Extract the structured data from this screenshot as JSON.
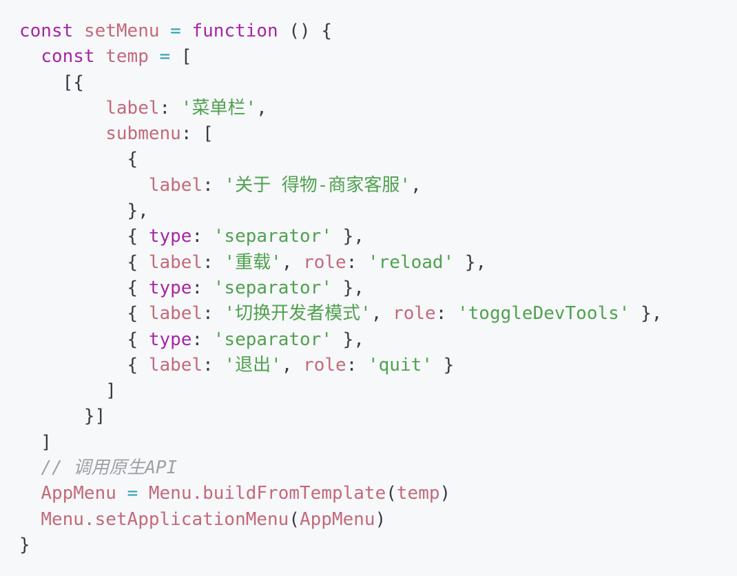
{
  "code": {
    "lines": [
      [
        [
          "kw",
          "const"
        ],
        [
          "punc",
          " "
        ],
        [
          "var",
          "setMenu"
        ],
        [
          "punc",
          " "
        ],
        [
          "op",
          "="
        ],
        [
          "punc",
          " "
        ],
        [
          "kw",
          "function"
        ],
        [
          "punc",
          " () {"
        ]
      ],
      [
        [
          "punc",
          "  "
        ],
        [
          "kw",
          "const"
        ],
        [
          "punc",
          " "
        ],
        [
          "var",
          "temp"
        ],
        [
          "punc",
          " "
        ],
        [
          "op",
          "="
        ],
        [
          "punc",
          " ["
        ]
      ],
      [
        [
          "punc",
          "    [{"
        ]
      ],
      [
        [
          "punc",
          "        "
        ],
        [
          "var",
          "label"
        ],
        [
          "punc",
          ": "
        ],
        [
          "str",
          "'菜单栏'"
        ],
        [
          "punc",
          ","
        ]
      ],
      [
        [
          "punc",
          "        "
        ],
        [
          "var",
          "submenu"
        ],
        [
          "punc",
          ": ["
        ]
      ],
      [
        [
          "punc",
          "          {"
        ]
      ],
      [
        [
          "punc",
          "            "
        ],
        [
          "var",
          "label"
        ],
        [
          "punc",
          ": "
        ],
        [
          "str",
          "'关于 得物-商家客服'"
        ],
        [
          "punc",
          ","
        ]
      ],
      [
        [
          "punc",
          "          },"
        ]
      ],
      [
        [
          "punc",
          "          { "
        ],
        [
          "kw",
          "type"
        ],
        [
          "punc",
          ": "
        ],
        [
          "str",
          "'separator'"
        ],
        [
          "punc",
          " },"
        ]
      ],
      [
        [
          "punc",
          "          { "
        ],
        [
          "var",
          "label"
        ],
        [
          "punc",
          ": "
        ],
        [
          "str",
          "'重载'"
        ],
        [
          "punc",
          ", "
        ],
        [
          "var",
          "role"
        ],
        [
          "punc",
          ": "
        ],
        [
          "str",
          "'reload'"
        ],
        [
          "punc",
          " },"
        ]
      ],
      [
        [
          "punc",
          "          { "
        ],
        [
          "kw",
          "type"
        ],
        [
          "punc",
          ": "
        ],
        [
          "str",
          "'separator'"
        ],
        [
          "punc",
          " },"
        ]
      ],
      [
        [
          "punc",
          "          { "
        ],
        [
          "var",
          "label"
        ],
        [
          "punc",
          ": "
        ],
        [
          "str",
          "'切换开发者模式'"
        ],
        [
          "punc",
          ", "
        ],
        [
          "var",
          "role"
        ],
        [
          "punc",
          ": "
        ],
        [
          "str",
          "'toggleDevTools'"
        ],
        [
          "punc",
          " },"
        ]
      ],
      [
        [
          "punc",
          "          { "
        ],
        [
          "kw",
          "type"
        ],
        [
          "punc",
          ": "
        ],
        [
          "str",
          "'separator'"
        ],
        [
          "punc",
          " },"
        ]
      ],
      [
        [
          "punc",
          "          { "
        ],
        [
          "var",
          "label"
        ],
        [
          "punc",
          ": "
        ],
        [
          "str",
          "'退出'"
        ],
        [
          "punc",
          ", "
        ],
        [
          "var",
          "role"
        ],
        [
          "punc",
          ": "
        ],
        [
          "str",
          "'quit'"
        ],
        [
          "punc",
          " }"
        ]
      ],
      [
        [
          "punc",
          "        ]"
        ]
      ],
      [
        [
          "punc",
          "      }]"
        ]
      ],
      [
        [
          "punc",
          "  ]"
        ]
      ],
      [
        [
          "punc",
          "  "
        ],
        [
          "cmt",
          "// 调用原生API"
        ]
      ],
      [
        [
          "punc",
          "  "
        ],
        [
          "var",
          "AppMenu"
        ],
        [
          "punc",
          " "
        ],
        [
          "op",
          "="
        ],
        [
          "punc",
          " "
        ],
        [
          "var",
          "Menu.buildFromTemplate"
        ],
        [
          "punc",
          "("
        ],
        [
          "var",
          "temp"
        ],
        [
          "punc",
          ")"
        ]
      ],
      [
        [
          "punc",
          "  "
        ],
        [
          "var",
          "Menu.setApplicationMenu"
        ],
        [
          "punc",
          "("
        ],
        [
          "var",
          "AppMenu"
        ],
        [
          "punc",
          ")"
        ]
      ],
      [
        [
          "punc",
          "}"
        ]
      ]
    ]
  },
  "colors": {
    "background": "#f6f8fa",
    "keyword": "#a626a4",
    "identifier": "#c4697a",
    "operator": "#2aa1b3",
    "string": "#50a14f",
    "punctuation": "#383a42",
    "comment": "#a0a1a7"
  }
}
